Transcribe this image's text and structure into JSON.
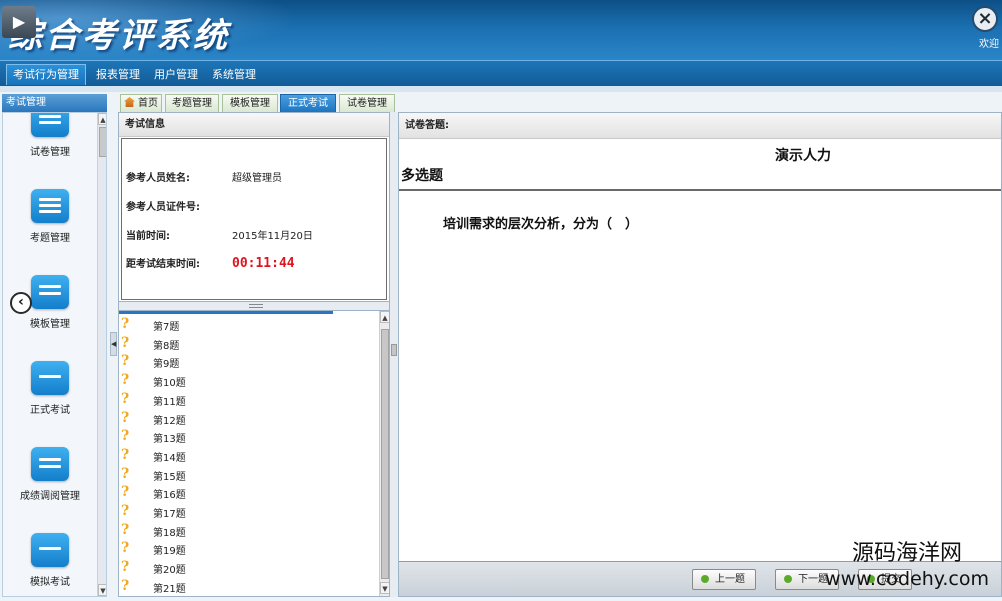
{
  "header": {
    "title": "综合考评系统",
    "welcome": "欢迎"
  },
  "menu": {
    "items": [
      {
        "label": "考试行为管理",
        "active": true
      },
      {
        "label": "报表管理"
      },
      {
        "label": "用户管理"
      },
      {
        "label": "系统管理"
      }
    ]
  },
  "sidebar": {
    "header": "考试管理",
    "items": [
      {
        "label": "试卷管理",
        "icon": "paper-icon"
      },
      {
        "label": "考题管理",
        "icon": "list-icon"
      },
      {
        "label": "模板管理",
        "icon": "template-icon"
      },
      {
        "label": "正式考试",
        "icon": "exam-icon"
      },
      {
        "label": "成绩调阅管理",
        "icon": "score-icon"
      },
      {
        "label": "模拟考试",
        "icon": "mock-exam-icon"
      }
    ]
  },
  "tabs": [
    {
      "label": "首页",
      "icon": "home-icon"
    },
    {
      "label": "考题管理"
    },
    {
      "label": "模板管理"
    },
    {
      "label": "正式考试",
      "active": true
    },
    {
      "label": "试卷管理"
    }
  ],
  "exam_info": {
    "panel_title": "考试信息",
    "name_label": "参考人员姓名:",
    "name_value": "超级管理员",
    "id_label": "参考人员证件号:",
    "id_value": "",
    "time_label": "当前时间:",
    "time_value": "2015年11月20日",
    "remain_label": "距考试结束时间:",
    "remain_value": "00:11:44"
  },
  "questions": [
    "第7题",
    "第8题",
    "第9题",
    "第10题",
    "第11题",
    "第12题",
    "第13题",
    "第14题",
    "第15题",
    "第16题",
    "第17题",
    "第18题",
    "第19题",
    "第20题",
    "第21题"
  ],
  "answer": {
    "panel_title": "试卷答题:",
    "paper_title": "演示人力",
    "section": "多选题",
    "question": "培训需求的层次分析，分为（　）",
    "prev_label": "上一题",
    "next_label": "下一题",
    "submit_label": "提交"
  },
  "watermark": {
    "name": "源码海洋网",
    "url": "www.codehy.com"
  },
  "colors": {
    "header_blue": "#1a6fb0",
    "timer_red": "#e0141e",
    "active_tab": "#1d75c0"
  }
}
